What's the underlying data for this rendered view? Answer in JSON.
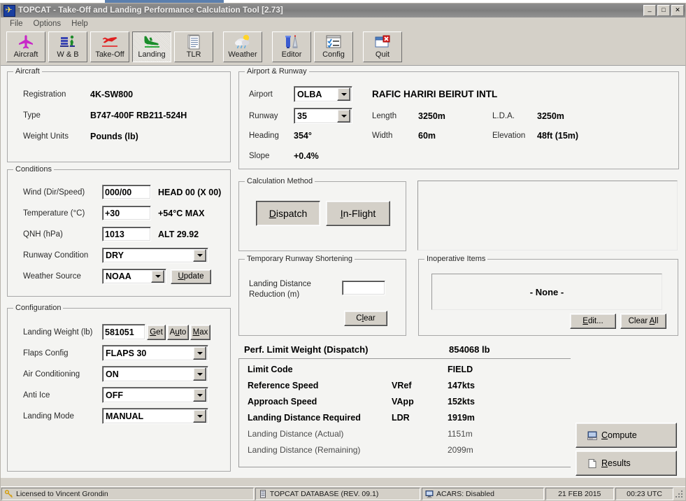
{
  "window": {
    "title": "TOPCAT - Take-Off and Landing Performance Calculation Tool [2.73]",
    "app_icon": "airplane-icon",
    "minimize": "_",
    "maximize": "□",
    "close": "✕"
  },
  "menu": [
    {
      "label": "File"
    },
    {
      "label": "Options"
    },
    {
      "label": "Help"
    }
  ],
  "toolbar": [
    {
      "label": "Aircraft",
      "icon": "airplane-top-view-icon",
      "selected": false
    },
    {
      "label": "W & B",
      "icon": "weight-balance-icon",
      "selected": false
    },
    {
      "label": "Take-Off",
      "icon": "takeoff-plane-icon",
      "selected": false
    },
    {
      "label": "Landing",
      "icon": "landing-plane-icon",
      "selected": true
    },
    {
      "label": "TLR",
      "icon": "document-icon",
      "selected": false
    },
    {
      "label": "Weather",
      "icon": "cloud-sun-icon",
      "selected": false
    },
    {
      "label": "Editor",
      "icon": "editor-tower-icon",
      "selected": false
    },
    {
      "label": "Config",
      "icon": "checklist-window-icon",
      "selected": false
    },
    {
      "label": "Quit",
      "icon": "close-window-icon",
      "selected": false
    }
  ],
  "aircraft": {
    "caption": "Aircraft",
    "registration_label": "Registration",
    "registration_value": "4K-SW800",
    "type_label": "Type",
    "type_value": "B747-400F RB211-524H",
    "weight_units_label": "Weight Units",
    "weight_units_value": "Pounds (lb)"
  },
  "conditions": {
    "caption": "Conditions",
    "wind_label": "Wind (Dir/Speed)",
    "wind_value": "000/00",
    "wind_note": "HEAD 00  (X 00)",
    "temperature_label": "Temperature (°C)",
    "temperature_value": "+30",
    "temperature_note": "+54°C MAX",
    "qnh_label": "QNH (hPa)",
    "qnh_value": "1013",
    "qnh_note": "ALT 29.92",
    "runway_condition_label": "Runway Condition",
    "runway_condition_value": "DRY",
    "weather_source_label": "Weather Source",
    "weather_source_value": "NOAA",
    "update_button": "Update"
  },
  "configuration": {
    "caption": "Configuration",
    "landing_weight_label": "Landing Weight (lb)",
    "landing_weight_value": "581051",
    "get_button": "Get",
    "auto_button": "Auto",
    "max_button": "Max",
    "flaps_label": "Flaps Config",
    "flaps_value": "FLAPS 30",
    "air_cond_label": "Air Conditioning",
    "air_cond_value": "ON",
    "anti_ice_label": "Anti Ice",
    "anti_ice_value": "OFF",
    "landing_mode_label": "Landing Mode",
    "landing_mode_value": "MANUAL"
  },
  "airport": {
    "caption": "Airport & Runway",
    "airport_label": "Airport",
    "airport_value": "OLBA",
    "airport_name": "RAFIC HARIRI BEIRUT INTL",
    "runway_label": "Runway",
    "runway_value": "35",
    "length_label": "Length",
    "length_value": "3250m",
    "lda_label": "L.D.A.",
    "lda_value": "3250m",
    "heading_label": "Heading",
    "heading_value": "354°",
    "width_label": "Width",
    "width_value": "60m",
    "elevation_label": "Elevation",
    "elevation_value": "48ft (15m)",
    "slope_label": "Slope",
    "slope_value": "+0.4%"
  },
  "calc_method": {
    "caption": "Calculation Method",
    "dispatch_button": "Dispatch",
    "inflight_button": "In-Flight",
    "selected": "Dispatch"
  },
  "messages": {
    "text": ""
  },
  "shortening": {
    "caption": "Temporary Runway Shortening",
    "reduction_label_line1": "Landing Distance",
    "reduction_label_line2": "Reduction (m)",
    "reduction_value": "",
    "clear_button": "Clear"
  },
  "inop": {
    "caption": "Inoperative Items",
    "list_text": "- None -",
    "edit_button": "Edit...",
    "clear_all_button": "Clear All"
  },
  "results": {
    "title": "Perf. Limit Weight (Dispatch)",
    "title_value": "854068 lb",
    "rows": [
      {
        "label": "Limit Code",
        "code": "",
        "value": "FIELD",
        "bold": true
      },
      {
        "label": "Reference Speed",
        "code": "VRef",
        "value": "147kts",
        "bold": true
      },
      {
        "label": "Approach Speed",
        "code": "VApp",
        "value": "152kts",
        "bold": true
      },
      {
        "label": "Landing Distance Required",
        "code": "LDR",
        "value": "1919m",
        "bold": true
      },
      {
        "label": "Landing Distance (Actual)",
        "code": "",
        "value": "1151m",
        "bold": false
      },
      {
        "label": "Landing Distance (Remaining)",
        "code": "",
        "value": "2099m",
        "bold": false
      }
    ]
  },
  "actions": {
    "compute_button": "Compute",
    "compute_icon": "computer-icon",
    "results_button": "Results",
    "results_icon": "page-icon"
  },
  "statusbar": {
    "license": "Licensed to Vincent Grondin",
    "license_icon": "key-icon",
    "database": "TOPCAT DATABASE (REV. 09.1)",
    "database_icon": "database-icon",
    "acars": "ACARS: Disabled",
    "acars_icon": "monitor-icon",
    "date": "21 FEB 2015",
    "time": "00:23 UTC"
  },
  "colors": {
    "face": "#d4d0c8",
    "client": "#f4f4f2",
    "title_start": "#8e8e8e",
    "title_end": "#949494",
    "accent_blue": "#1a3fa0",
    "accent_yellow": "#ffe24d"
  }
}
